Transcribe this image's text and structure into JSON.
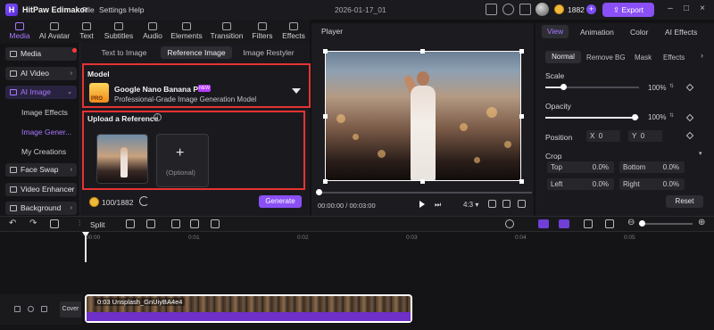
{
  "titlebar": {
    "app_title": "HitPaw Edimakor",
    "menu": [
      "File",
      "Settings",
      "Help"
    ],
    "document_title": "2026-01-17_01",
    "credits": "1882",
    "export_label": "Export"
  },
  "tool_tabs": [
    "Media",
    "AI Avatar",
    "Text",
    "Subtitles",
    "Audio",
    "Elements",
    "Transition",
    "Filters",
    "Effects"
  ],
  "sidebar": {
    "categories": [
      "Media",
      "AI Video",
      "AI Image",
      "Face Swap",
      "Video Enhancer",
      "Background"
    ],
    "sub_items": [
      "Image Effects",
      "Image Gener...",
      "My Creations"
    ]
  },
  "image_panel": {
    "subtabs": [
      "Text to Image",
      "Reference Image",
      "Image Restyler"
    ],
    "model_label": "Model",
    "model_name": "Google Nano Banana Pro",
    "model_badge": "NEW",
    "model_thumb_text": "PRO",
    "model_desc": "Professional-Grade Image Generation Model",
    "upload_label": "Upload a Reference",
    "optional_text": "(Optional)",
    "credit_text": "100/1882",
    "generate_label": "Generate"
  },
  "player": {
    "label": "Player",
    "timecode": "00:00:00 / 00:03:00",
    "ratio": "4:3",
    "progress": 0
  },
  "right_panel": {
    "tabs": [
      "View",
      "Animation",
      "Color",
      "AI Effects"
    ],
    "subtabs": [
      "Normal",
      "Remove BG",
      "Mask",
      "Effects"
    ],
    "scale_label": "Scale",
    "scale_value": "100%",
    "opacity_label": "Opacity",
    "opacity_value": "100%",
    "position_label": "Position",
    "pos_x_label": "X",
    "pos_x_value": "0",
    "pos_y_label": "Y",
    "pos_y_value": "0",
    "crop_label": "Crop",
    "crop": [
      {
        "label": "Top",
        "value": "0.0%"
      },
      {
        "label": "Bottom",
        "value": "0.0%"
      },
      {
        "label": "Left",
        "value": "0.0%"
      },
      {
        "label": "Right",
        "value": "0.0%"
      }
    ],
    "reset_label": "Reset"
  },
  "timeline": {
    "split_label": "Split",
    "ruler": [
      "00:00",
      "0:01",
      "0:02",
      "0:03",
      "0:04",
      "0:05"
    ],
    "cover_label": "Cover",
    "clip_label": "0:03 Unsplash_GnUiyBA4e4"
  },
  "colors": {
    "accent": "#8a50f5",
    "highlight_box": "#e53333"
  }
}
